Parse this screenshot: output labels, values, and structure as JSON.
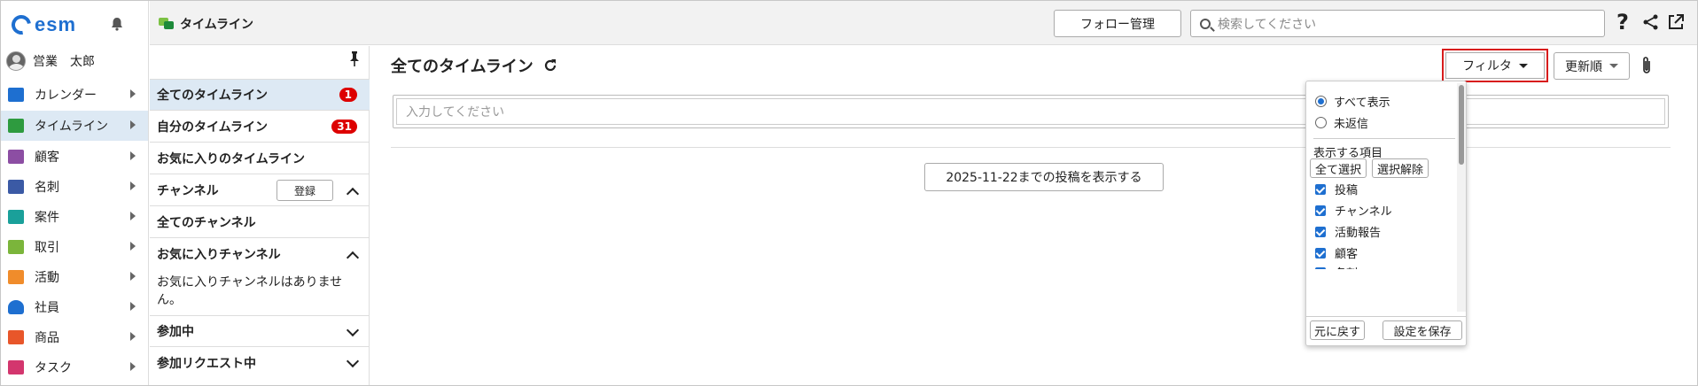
{
  "brand": {
    "logo_text": "esm"
  },
  "user": {
    "name": "営業　太郎"
  },
  "nav": {
    "items": [
      {
        "label": "カレンダー",
        "icon": "calendar-icon",
        "color": "#1e6fd0"
      },
      {
        "label": "タイムライン",
        "icon": "timeline-icon",
        "color": "#2e9b3f",
        "active": true
      },
      {
        "label": "顧客",
        "icon": "building-icon",
        "color": "#8c4ea3"
      },
      {
        "label": "名刺",
        "icon": "business-card-icon",
        "color": "#3b5aa5"
      },
      {
        "label": "案件",
        "icon": "folder-icon",
        "color": "#1aa09a"
      },
      {
        "label": "取引",
        "icon": "ledger-icon",
        "color": "#7bb53b"
      },
      {
        "label": "活動",
        "icon": "clipboard-icon",
        "color": "#f08c2b"
      },
      {
        "label": "社員",
        "icon": "person-icon",
        "color": "#1e6fd0"
      },
      {
        "label": "商品",
        "icon": "product-icon",
        "color": "#e8562a"
      },
      {
        "label": "タスク",
        "icon": "checkbox-icon",
        "color": "#d3366e"
      }
    ]
  },
  "topbar": {
    "title": "タイムライン",
    "follow_label": "フォロー管理",
    "search_placeholder": "検索してください",
    "help_label": "?"
  },
  "mid": {
    "all_timeline": "全てのタイムライン",
    "all_badge": "1",
    "my_timeline": "自分のタイムライン",
    "my_badge": "31",
    "fav_timeline": "お気に入りのタイムライン",
    "channel": "チャンネル",
    "register": "登録",
    "all_channel": "全てのチャンネル",
    "fav_channel": "お気に入りチャンネル",
    "no_fav": "お気に入りチャンネルはありません。",
    "joined": "参加中",
    "requested": "参加リクエスト中"
  },
  "main": {
    "title": "全てのタイムライン",
    "filter_label": "フィルタ",
    "sort_label": "更新順",
    "input_placeholder": "入力してください",
    "show_posts": "2025-11-22までの投稿を表示する"
  },
  "filter": {
    "radio_all": "すべて表示",
    "radio_unreplied": "未返信",
    "items_heading": "表示する項目",
    "select_all": "全て選択",
    "deselect": "選択解除",
    "items": [
      "投稿",
      "チャンネル",
      "活動報告",
      "顧客",
      "名刺"
    ],
    "reset": "元に戻す",
    "save": "設定を保存"
  }
}
